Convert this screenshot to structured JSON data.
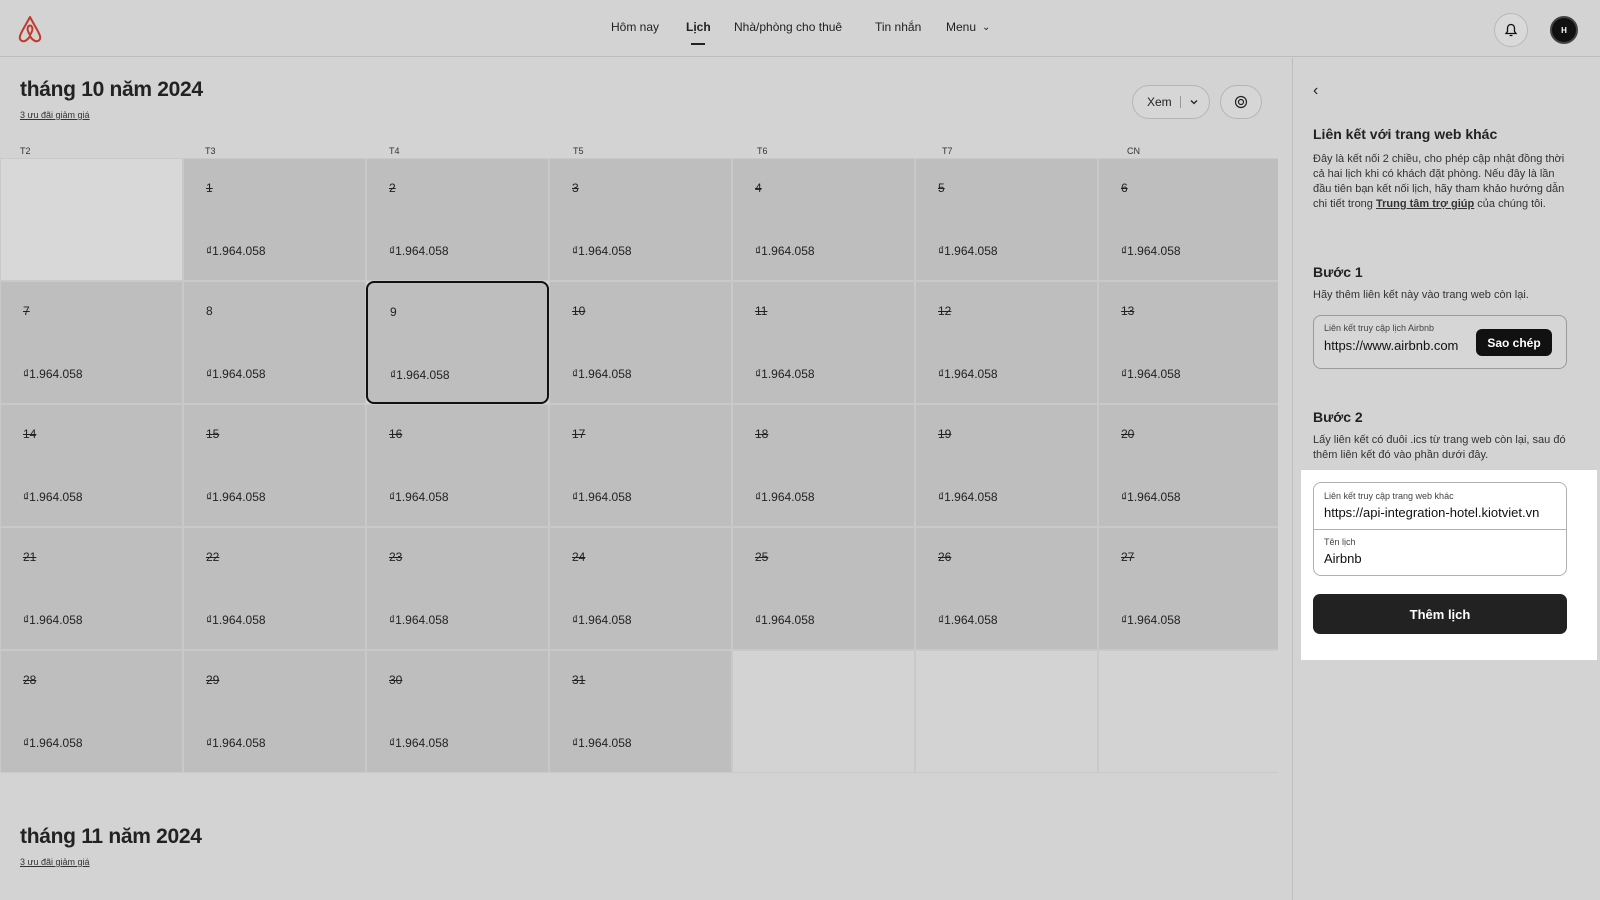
{
  "header": {
    "nav": [
      "Hôm nay",
      "Lịch",
      "Nhà/phòng cho thuê",
      "Tin nhắn",
      "Menu"
    ],
    "active_nav": "Lịch",
    "avatar_initial": "H"
  },
  "calendar": {
    "view_label": "Xem",
    "days_of_week": [
      "T2",
      "T3",
      "T4",
      "T5",
      "T6",
      "T7",
      "CN"
    ],
    "months": [
      {
        "title": "tháng 10 năm 2024",
        "subtitle": "3 ưu đãi giảm giá"
      },
      {
        "title": "tháng 11 năm 2024",
        "subtitle": "3 ưu đãi giảm giá"
      }
    ],
    "price": "₫1.964.058",
    "selected_day": "9",
    "october_days": [
      [
        "",
        "1",
        "2",
        "3",
        "4",
        "5",
        "6"
      ],
      [
        "7",
        "8",
        "9",
        "10",
        "11",
        "12",
        "13"
      ],
      [
        "14",
        "15",
        "16",
        "17",
        "18",
        "19",
        "20"
      ],
      [
        "21",
        "22",
        "23",
        "24",
        "25",
        "26",
        "27"
      ],
      [
        "28",
        "29",
        "30",
        "31",
        "",
        "",
        ""
      ]
    ]
  },
  "panel": {
    "title": "Liên kết với trang web khác",
    "description_start": "Đây là kết nối 2 chiều, cho phép cập nhật đồng thời cả hai lịch khi có khách đặt phòng. Nếu đây là lần đầu tiên bạn kết nối lịch, hãy tham khảo hướng dẫn chi tiết trong ",
    "description_link": "Trung tâm trợ giúp",
    "description_end": " của chúng tôi.",
    "step1": {
      "title": "Bước 1",
      "description": "Hãy thêm liên kết này vào trang web còn lại.",
      "field_label": "Liên kết truy cập lịch Airbnb",
      "field_value": "https://www.airbnb.com",
      "copy_label": "Sao chép"
    },
    "step2": {
      "title": "Bước 2",
      "description": "Lấy liên kết có đuôi .ics từ trang web còn lại, sau đó thêm liên kết đó vào phần dưới đây.",
      "url_label": "Liên kết truy cập trang web khác",
      "url_value": "https://api-integration-hotel.kiotviet.vn",
      "name_label": "Tên lịch",
      "name_value": "Airbnb",
      "add_label": "Thêm lịch"
    }
  }
}
